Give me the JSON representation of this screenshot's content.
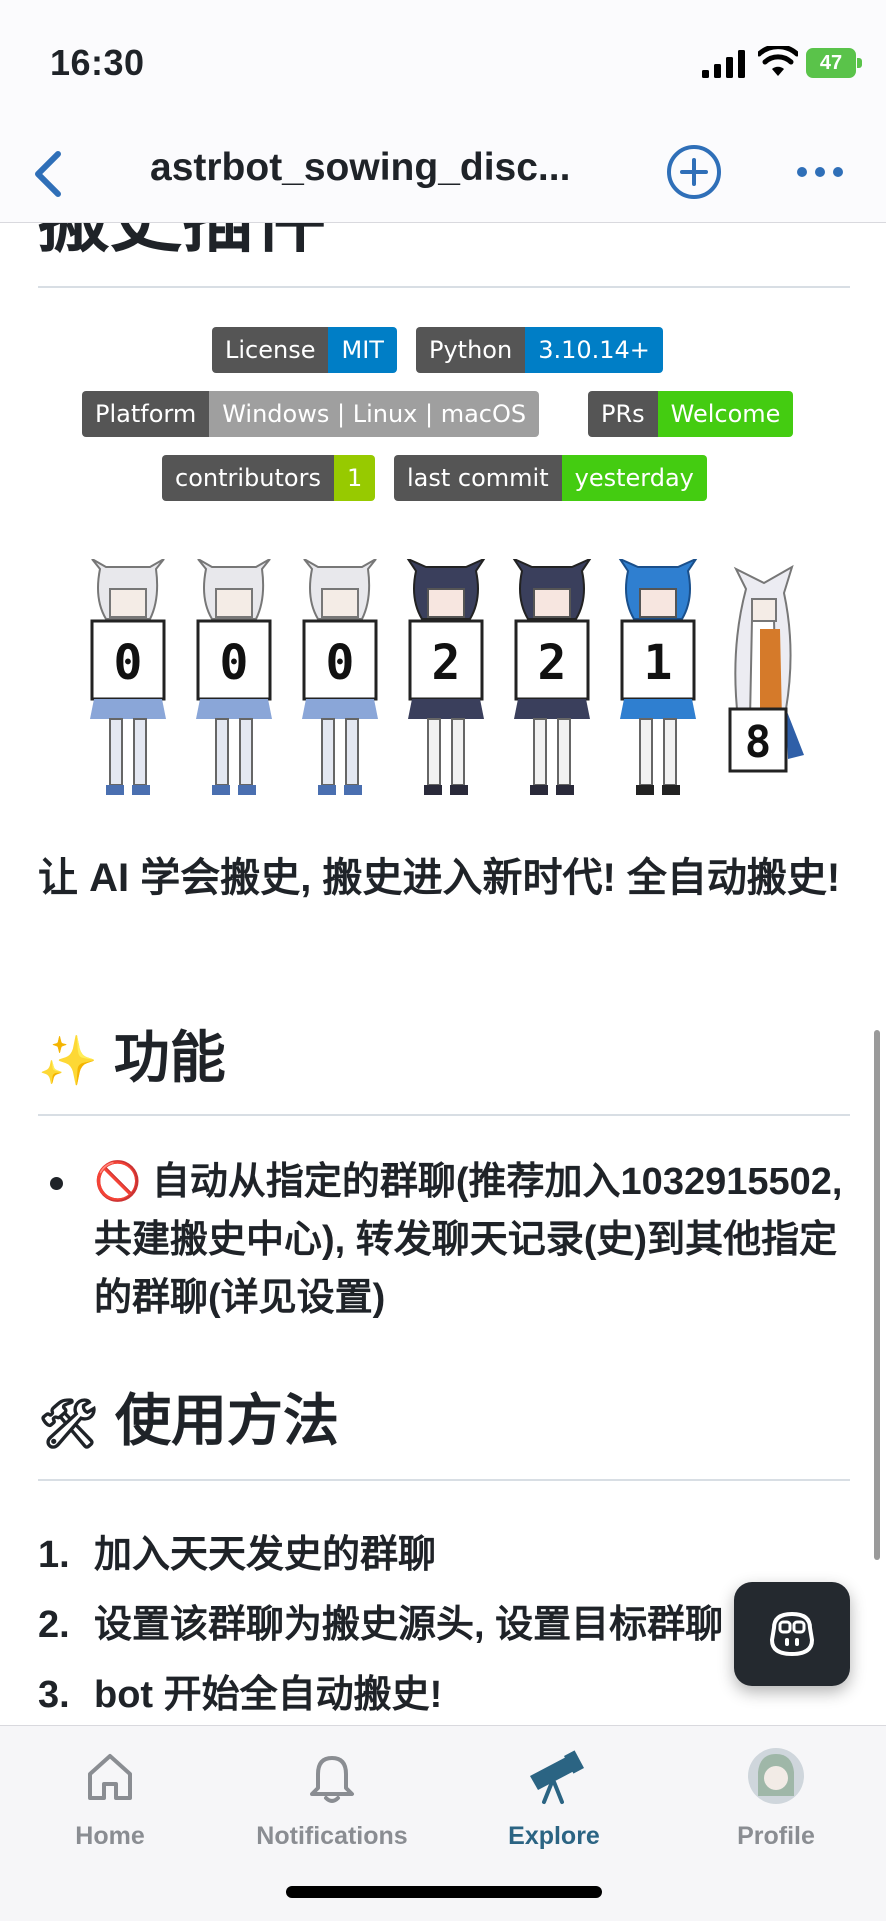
{
  "status_bar": {
    "time": "16:30",
    "battery": "47"
  },
  "header": {
    "title": "astrbot_sowing_disc..."
  },
  "readme": {
    "top_heading": "搬史插件",
    "badges": [
      {
        "label": "License",
        "value": "MIT",
        "color": "#007ec6"
      },
      {
        "label": "Python",
        "value": "3.10.14+",
        "color": "#007ec6"
      },
      {
        "label": "Platform",
        "value": "Windows | Linux | macOS",
        "color": "#9f9f9f"
      },
      {
        "label": "PRs",
        "value": "Welcome",
        "color": "#4c1"
      },
      {
        "label": "contributors",
        "value": "1",
        "color": "#97ca00"
      },
      {
        "label": "last commit",
        "value": "yesterday",
        "color": "#4c1"
      }
    ],
    "counter_digits": [
      "0",
      "0",
      "0",
      "2",
      "2",
      "1",
      "8"
    ],
    "intro": "让 AI 学会搬史, 搬史进入新时代! 全自动搬史!",
    "features": {
      "icon": "✨",
      "title": "功能",
      "items": [
        {
          "icon": "🚫",
          "text": "自动从指定的群聊(推荐加入1032915502, 共建搬史中心), 转发聊天记录(史)到其他指定的群聊(详见设置)"
        }
      ]
    },
    "usage": {
      "icon": "🛠",
      "title": "使用方法",
      "steps": [
        {
          "num": "1.",
          "text": "加入天天发史的群聊"
        },
        {
          "num": "2.",
          "text": "设置该群聊为搬史源头, 设置目标群聊"
        },
        {
          "num": "3.",
          "text": "bot 开始全自动搬史!"
        }
      ]
    }
  },
  "tab_bar": {
    "tabs": [
      {
        "label": "Home",
        "icon": "home-icon"
      },
      {
        "label": "Notifications",
        "icon": "bell-icon"
      },
      {
        "label": "Explore",
        "icon": "telescope-icon",
        "active": true
      },
      {
        "label": "Profile",
        "icon": "avatar"
      }
    ]
  }
}
